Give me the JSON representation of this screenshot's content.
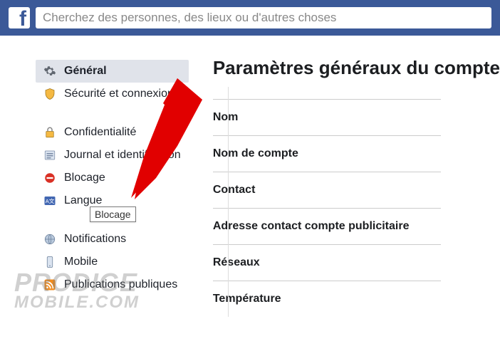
{
  "search": {
    "placeholder": "Cherchez des personnes, des lieux ou d'autres choses"
  },
  "sidebar": {
    "items": [
      {
        "label": "Général"
      },
      {
        "label": "Sécurité et connexion"
      },
      {
        "label": "Confidentialité"
      },
      {
        "label": "Journal et identification"
      },
      {
        "label": "Blocage"
      },
      {
        "label": "Langue"
      },
      {
        "label": "Notifications"
      },
      {
        "label": "Mobile"
      },
      {
        "label": "Publications publiques"
      }
    ]
  },
  "tooltip": "Blocage",
  "main": {
    "title": "Paramètres généraux du compte",
    "rows": [
      "Nom",
      "Nom de compte",
      "Contact",
      "Adresse contact compte publicitaire",
      "Réseaux",
      "Température"
    ]
  },
  "watermark": {
    "line1": "PRODIGE",
    "line2": "MOBILE.COM"
  }
}
